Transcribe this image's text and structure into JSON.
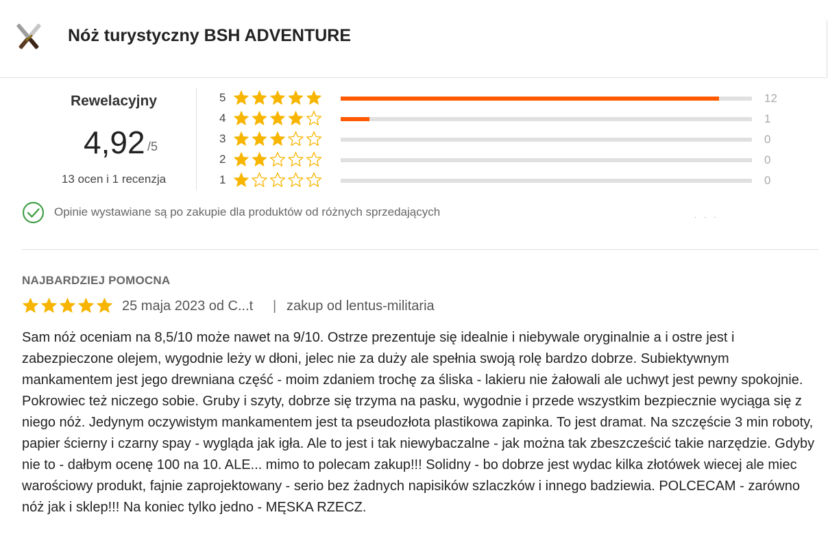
{
  "product": {
    "title": "Nóż turystyczny BSH ADVENTURE",
    "thumbnail_icon": "crossed-knives-icon"
  },
  "summary": {
    "grade_label": "Rewelacyjny",
    "average": "4,92",
    "out_of": "/5",
    "count_text": "13 ocen i 1 recenzja"
  },
  "distribution": [
    {
      "stars_label": "5",
      "stars": 5,
      "count": "12",
      "fraction": 0.92
    },
    {
      "stars_label": "4",
      "stars": 4,
      "count": "1",
      "fraction": 0.07
    },
    {
      "stars_label": "3",
      "stars": 3,
      "count": "0",
      "fraction": 0
    },
    {
      "stars_label": "2",
      "stars": 2,
      "count": "0",
      "fraction": 0
    },
    {
      "stars_label": "1",
      "stars": 1,
      "count": "0",
      "fraction": 0
    }
  ],
  "info": {
    "icon": "check-circle-icon",
    "text": "Opinie wystawiane są po zakupie dla produktów od różnych sprzedających"
  },
  "review": {
    "section_label": "NAJBARDZIEJ POMOCNA",
    "stars": 5,
    "date_author": "25 maja 2023 od C...t",
    "separator": "|",
    "seller": "zakup od lentus-militaria",
    "body": "Sam nóż oceniam na 8,5/10 może nawet na 9/10. Ostrze prezentuje się idealnie i niebywale oryginalnie a i ostre jest i zabezpieczone olejem, wygodnie leży w dłoni, jelec nie za duży ale spełnia swoją rolę bardzo dobrze. Subiektywnym mankamentem jest jego drewniana część - moim zdaniem trochę za śliska - lakieru nie żałowali ale uchwyt jest pewny spokojnie. Pokrowiec też niczego sobie. Gruby i szyty, dobrze się trzyma na pasku, wygodnie i przede wszystkim bezpiecznie wyciąga się z niego nóż. Jedynym oczywistym mankamentem jest ta pseudozłota plastikowa zapinka. To jest dramat. Na szczęście 3 min roboty, papier ścierny i czarny spay - wygląda jak igła. Ale to jest i tak niewybaczalne - jak można tak zbeszcześcić takie narzędzie. Gdyby nie to - dałbym ocenę 100 na 10. ALE... mimo to polecam zakup!!! Solidny - bo dobrze jest wydac kilka złotówek wiecej ale miec warościowy produkt, fajnie zaprojektowany - serio bez żadnych napisików szlaczków i innego badziewia. POLCECAM - zarówno nóż jak i sklep!!! Na koniec tylko jedno - MĘSKA RZECZ."
  },
  "colors": {
    "star": "#f7b500",
    "bar_fill": "#ff5a00",
    "bar_track": "#e0e0e0",
    "check": "#43a047"
  }
}
